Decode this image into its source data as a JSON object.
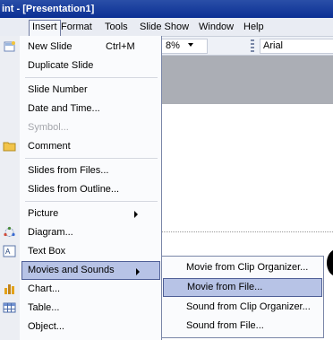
{
  "window": {
    "title": "int - [Presentation1]"
  },
  "menubar": {
    "items": [
      {
        "id": "insert",
        "label": "Insert"
      },
      {
        "id": "format",
        "label": "Format"
      },
      {
        "id": "tools",
        "label": "Tools"
      },
      {
        "id": "slideshow",
        "label": "Slide Show"
      },
      {
        "id": "window",
        "label": "Window"
      },
      {
        "id": "help",
        "label": "Help"
      }
    ]
  },
  "toolbar": {
    "zoom_value": "8%",
    "font_name": "Arial"
  },
  "insert_menu": {
    "new_slide": {
      "label": "New Slide",
      "accel": "Ctrl+M"
    },
    "duplicate_slide": {
      "label": "Duplicate Slide"
    },
    "slide_number": {
      "label": "Slide Number"
    },
    "date_time": {
      "label": "Date and Time..."
    },
    "symbol": {
      "label": "Symbol..."
    },
    "comment": {
      "label": "Comment"
    },
    "slides_from_files": {
      "label": "Slides from Files..."
    },
    "slides_from_outline": {
      "label": "Slides from Outline..."
    },
    "picture": {
      "label": "Picture"
    },
    "diagram": {
      "label": "Diagram..."
    },
    "text_box": {
      "label": "Text Box"
    },
    "movies_sounds": {
      "label": "Movies and Sounds"
    },
    "chart": {
      "label": "Chart..."
    },
    "table": {
      "label": "Table..."
    },
    "object": {
      "label": "Object..."
    }
  },
  "movies_submenu": {
    "items": [
      {
        "label": "Movie from Clip Organizer..."
      },
      {
        "label": "Movie from File..."
      },
      {
        "label": "Sound from Clip Organizer..."
      },
      {
        "label": "Sound from File..."
      }
    ]
  }
}
